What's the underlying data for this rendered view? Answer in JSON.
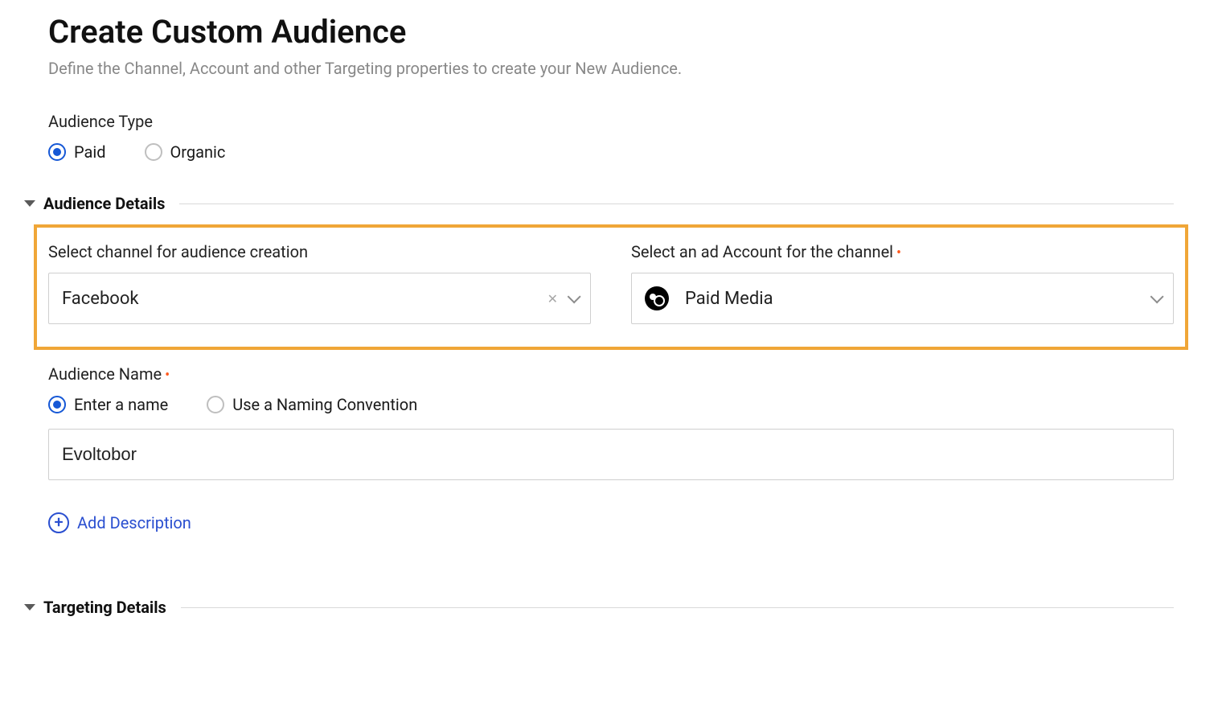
{
  "page": {
    "title": "Create Custom Audience",
    "subtitle": "Define the Channel, Account and other Targeting properties to create your New Audience."
  },
  "audience_type": {
    "label": "Audience Type",
    "options": [
      "Paid",
      "Organic"
    ],
    "selected": "Paid"
  },
  "sections": {
    "details_title": "Audience Details",
    "targeting_title": "Targeting Details"
  },
  "channel_field": {
    "label": "Select channel for audience creation",
    "value": "Facebook"
  },
  "account_field": {
    "label": "Select an ad Account for the channel",
    "value": "Paid Media"
  },
  "audience_name": {
    "label": "Audience Name",
    "options": [
      "Enter a name",
      "Use a Naming Convention"
    ],
    "selected": "Enter a name",
    "value": "Evoltobor"
  },
  "add_description": "Add Description"
}
